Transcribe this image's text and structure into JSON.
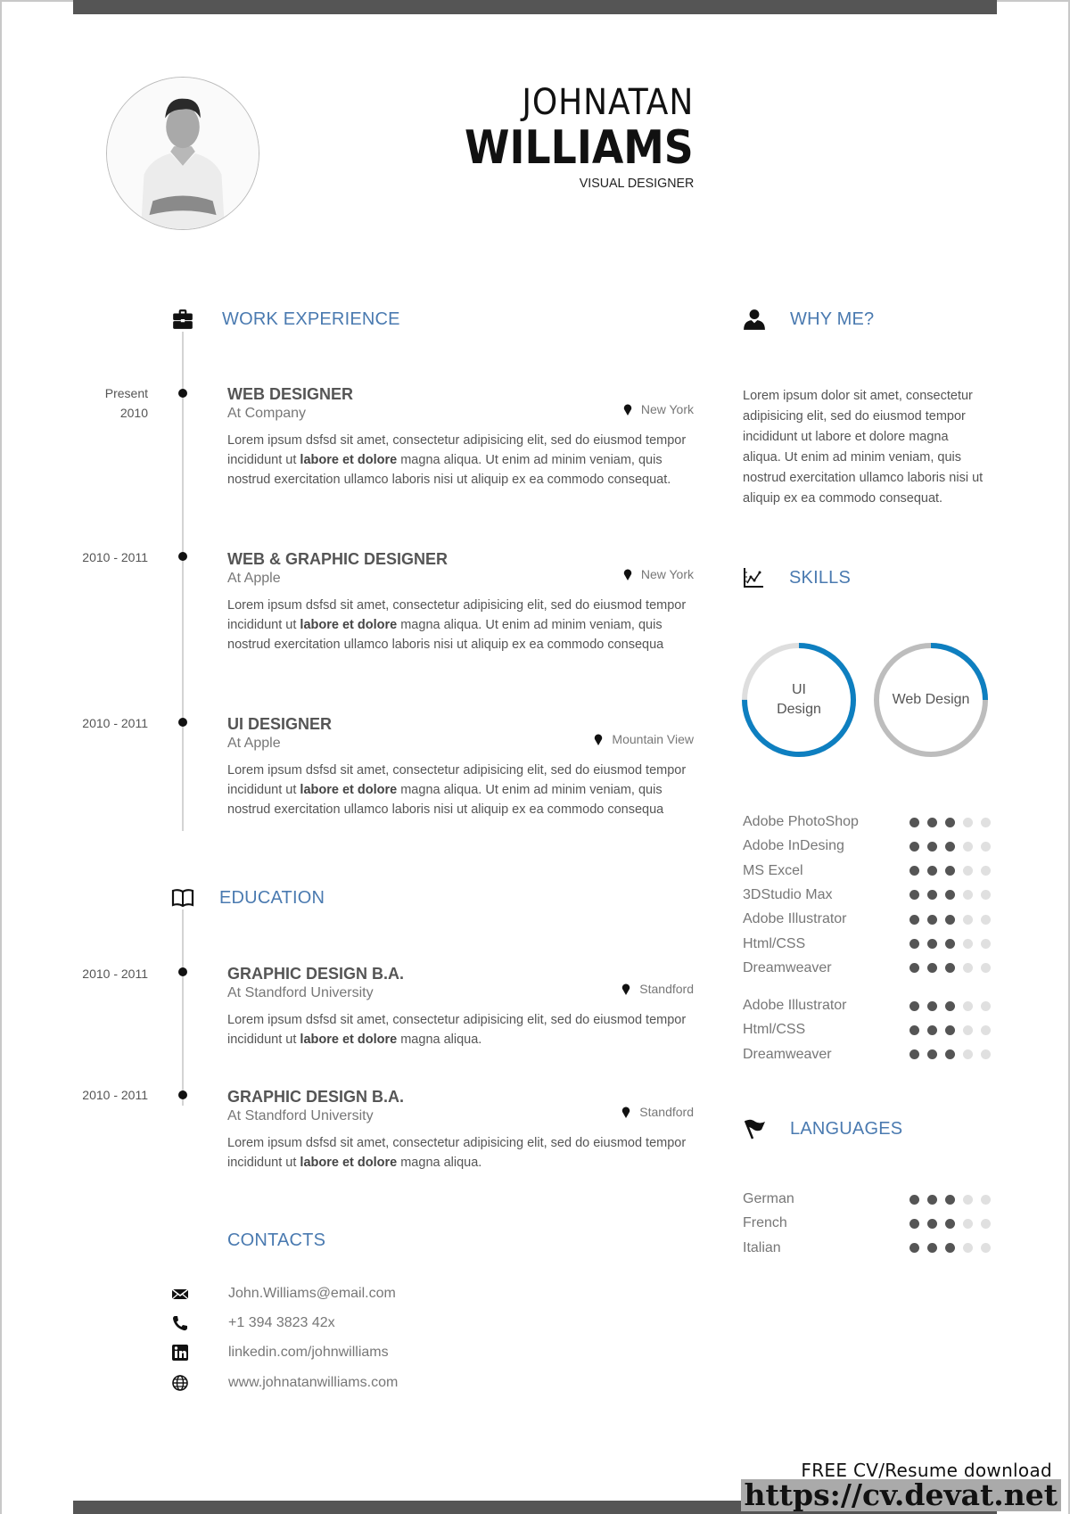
{
  "header": {
    "first_name": "JOHNATAN",
    "last_name": "WILLIAMS",
    "role": "VISUAL DESIGNER",
    "photo_icon": "profile-photo"
  },
  "sections": {
    "work": {
      "title": "WORK EXPERIENCE",
      "icon": "briefcase-icon"
    },
    "education": {
      "title": "EDUCATION",
      "icon": "book-icon"
    },
    "contacts": {
      "title": "CONTACTS"
    },
    "why": {
      "title": "WHY ME?",
      "icon": "user-icon"
    },
    "skills": {
      "title": "SKILLS",
      "icon": "chart-icon"
    },
    "languages": {
      "title": "LANGUAGES",
      "icon": "flag-icon"
    }
  },
  "work": [
    {
      "date_line1": "Present",
      "date_line2": "2010",
      "title": "WEB DESIGNER",
      "org": "At Company",
      "location": "New York",
      "desc_a": "Lorem ipsum dsfsd sit amet, consectetur adipisicing elit, sed do eiusmod tempor incididunt ut ",
      "desc_bold": "labore et dolore",
      "desc_b": " magna aliqua. Ut enim ad minim veniam, quis nostrud exercitation ullamco laboris nisi ut aliquip ex ea commodo consequat."
    },
    {
      "date_line1": "2010 - 2011",
      "title": "WEB & GRAPHIC DESIGNER",
      "org": "At Apple",
      "location": "New York",
      "desc_a": "Lorem ipsum dsfsd sit amet, consectetur adipisicing elit, sed do eiusmod tempor incididunt ut ",
      "desc_bold": "labore et dolore",
      "desc_b": " magna aliqua. Ut enim ad minim veniam, quis nostrud exercitation ullamco laboris nisi ut aliquip ex ea commodo consequa"
    },
    {
      "date_line1": "2010 - 2011",
      "title": "UI DESIGNER",
      "org": "At Apple",
      "location": "Mountain View",
      "desc_a": "Lorem ipsum dsfsd sit amet, consectetur adipisicing elit, sed do eiusmod tempor incididunt ut ",
      "desc_bold": "labore et dolore",
      "desc_b": " magna aliqua. Ut enim ad minim veniam, quis nostrud exercitation ullamco laboris nisi ut aliquip ex ea commodo consequa"
    }
  ],
  "education": [
    {
      "date_line1": "2010 - 2011",
      "title": "GRAPHIC DESIGN B.A.",
      "org": "At Standford University",
      "location": "Standford",
      "desc_a": "Lorem ipsum dsfsd sit amet, consectetur adipisicing elit, sed do eiusmod tempor incididunt ut ",
      "desc_bold": "labore et dolore",
      "desc_b": " magna aliqua."
    },
    {
      "date_line1": "2010 - 2011",
      "title": "GRAPHIC DESIGN B.A.",
      "org": "At Standford University",
      "location": "Standford",
      "desc_a": "Lorem ipsum dsfsd sit amet, consectetur adipisicing elit, sed do eiusmod tempor incididunt ut ",
      "desc_bold": "labore et dolore",
      "desc_b": " magna aliqua."
    }
  ],
  "contacts": [
    {
      "icon": "email-icon",
      "text": "John.Williams@email.com"
    },
    {
      "icon": "phone-icon",
      "text": "+1 394 3823 42x"
    },
    {
      "icon": "linkedin-icon",
      "text": "linkedin.com/johnwilliams"
    },
    {
      "icon": "globe-icon",
      "text": "www.johnatanwilliams.com"
    }
  ],
  "why_text": "Lorem ipsum dolor sit amet, consectetur adipisicing elit, sed do eiusmod tempor incididunt ut labore et dolore magna aliqua. Ut enim ad minim veniam, quis nostrud exercitation ullamco laboris nisi ut aliquip ex ea commodo consequat.",
  "gauges": [
    {
      "label": "UI Design",
      "value_pct": 75
    },
    {
      "label": "Web Design",
      "value_pct": 25
    }
  ],
  "skills_group1": [
    {
      "name": "Adobe PhotoShop",
      "rating": 3,
      "max": 5
    },
    {
      "name": "Adobe InDesing",
      "rating": 3,
      "max": 5
    },
    {
      "name": "MS Excel",
      "rating": 3,
      "max": 5
    },
    {
      "name": "3DStudio Max",
      "rating": 3,
      "max": 5
    },
    {
      "name": "Adobe Illustrator",
      "rating": 3,
      "max": 5
    },
    {
      "name": "Html/CSS",
      "rating": 3,
      "max": 5
    },
    {
      "name": "Dreamweaver",
      "rating": 3,
      "max": 5
    }
  ],
  "skills_group2": [
    {
      "name": "Adobe Illustrator",
      "rating": 3,
      "max": 5
    },
    {
      "name": "Html/CSS",
      "rating": 3,
      "max": 5
    },
    {
      "name": "Dreamweaver",
      "rating": 3,
      "max": 5
    }
  ],
  "languages": [
    {
      "name": "German",
      "rating": 3,
      "max": 5
    },
    {
      "name": "French",
      "rating": 3,
      "max": 5
    },
    {
      "name": "Italian",
      "rating": 3,
      "max": 5
    }
  ],
  "colors": {
    "accent": "#4a7ab0",
    "gauge_fill": "#0e7fc0",
    "gauge_track_ui": "#dedede",
    "gauge_track_web": "#bdbdbd",
    "dot_on": "#555555",
    "dot_off": "#e0e0e0",
    "bar": "#555555"
  },
  "watermark": {
    "line1": "FREE CV/Resume download",
    "line2": "https://cv.devat.net"
  }
}
